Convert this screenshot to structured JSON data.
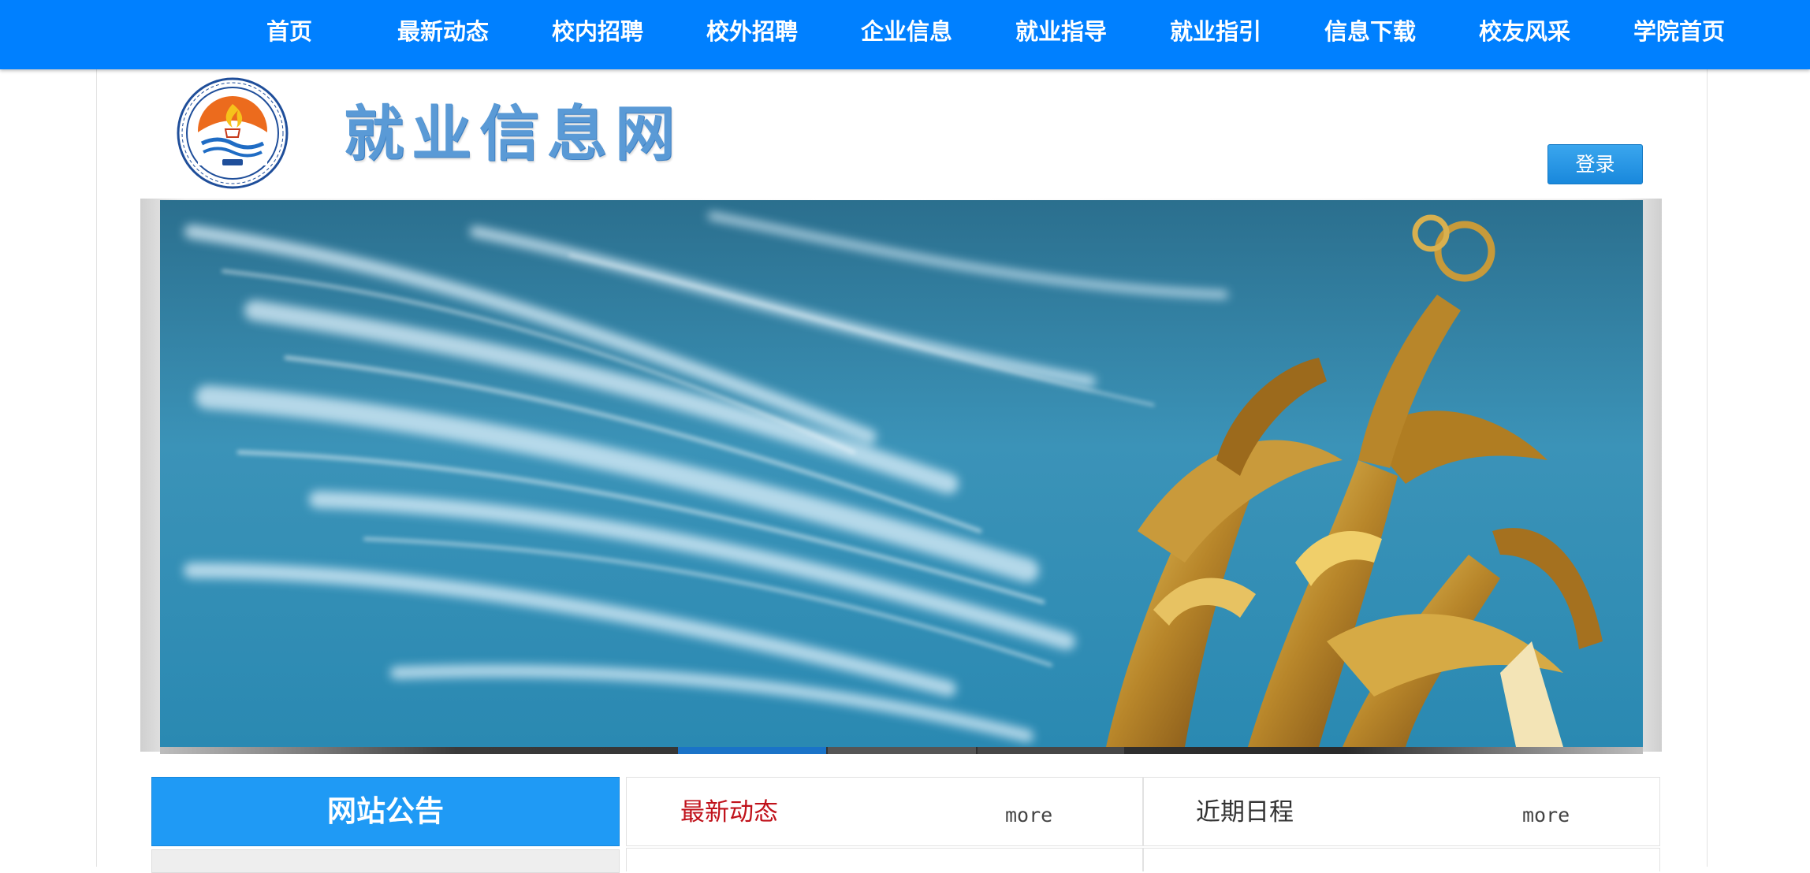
{
  "nav": {
    "items": [
      "首页",
      "最新动态",
      "校内招聘",
      "校外招聘",
      "企业信息",
      "就业指导",
      "就业指引",
      "信息下载",
      "校友风采",
      "学院首页"
    ]
  },
  "header": {
    "site_title": "就业信息网",
    "login_label": "登录",
    "logo_icon": "school-seal-icon"
  },
  "banner": {
    "image": "golden-statue-sky-photo",
    "active_slide": 2,
    "slide_count": 4
  },
  "panels": {
    "notice_title": "网站公告",
    "news_title": "最新动态",
    "news_more": "more",
    "schedule_title": "近期日程",
    "schedule_more": "more"
  },
  "colors": {
    "nav_bg": "#0080ff",
    "accent_blue": "#1f9af5",
    "news_title_red": "#c0111a",
    "slider_active": "#1a73c8"
  }
}
